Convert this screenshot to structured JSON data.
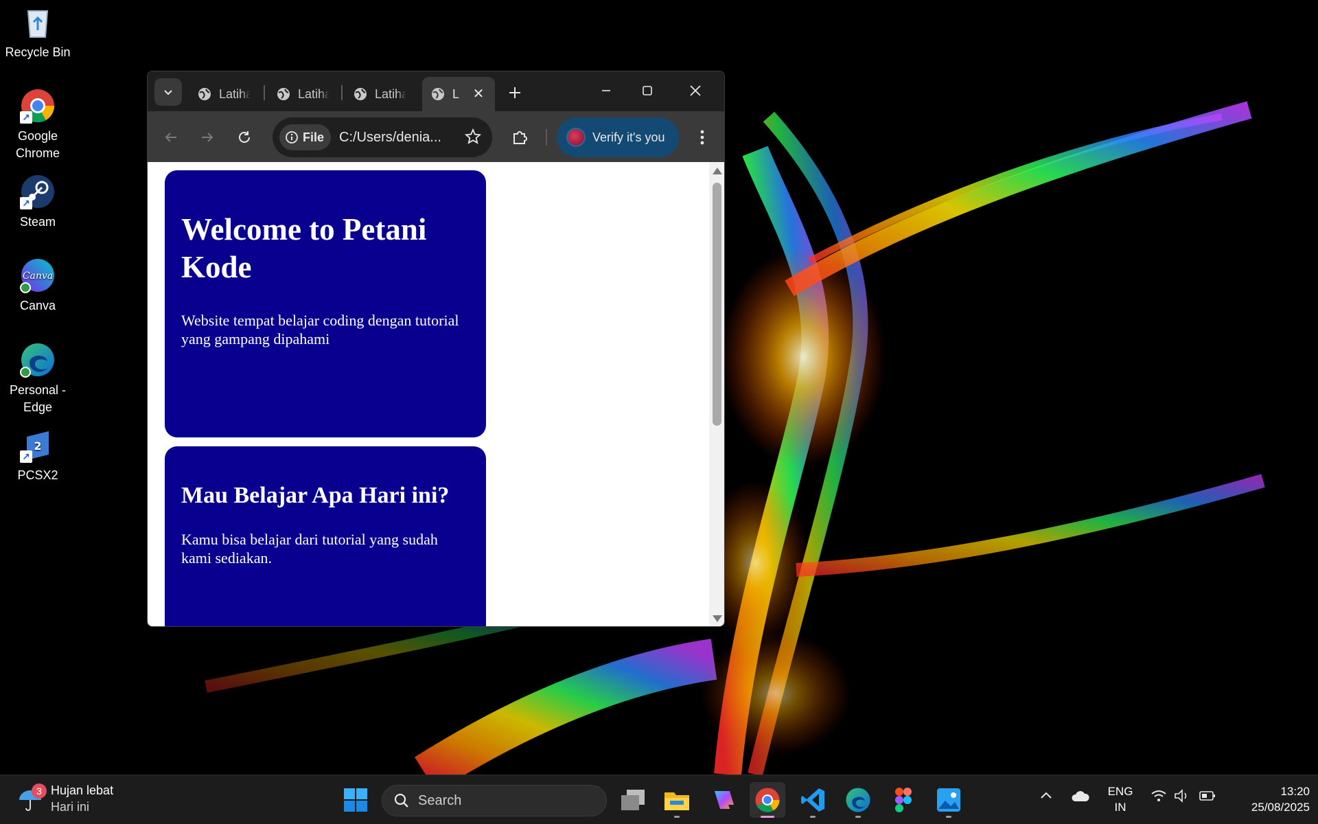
{
  "desktop": {
    "icons": [
      {
        "label": "Recycle Bin",
        "icon": "recycle-bin-icon"
      },
      {
        "label": "Google Chrome",
        "icon": "chrome-icon"
      },
      {
        "label": "Steam",
        "icon": "steam-icon"
      },
      {
        "label": "Canva",
        "icon": "canva-icon"
      },
      {
        "label": "Personal - Edge",
        "icon": "edge-icon"
      },
      {
        "label": "PCSX2",
        "icon": "pcsx2-icon"
      }
    ]
  },
  "browser": {
    "tabs": [
      {
        "title": "Latihan",
        "icon": "globe-icon",
        "active": false
      },
      {
        "title": "Latihan",
        "icon": "globe-icon",
        "active": false
      },
      {
        "title": "Latihan",
        "icon": "globe-icon",
        "active": false
      },
      {
        "title": "L",
        "icon": "globe-icon",
        "active": true
      }
    ],
    "omnibox": {
      "chip_label": "File",
      "url": "C:/Users/denia..."
    },
    "verify_label": "Verify it's you",
    "colors": {
      "frame": "#1f1f1f",
      "toolbar": "#3a3a3a",
      "verify": "#124a74"
    }
  },
  "page": {
    "cards": [
      {
        "heading": "Welcome to Petani Kode",
        "text": "Website tempat belajar coding dengan tutorial yang gampang dipahami"
      },
      {
        "heading": "Mau Belajar Apa Hari ini?",
        "text": "Kamu bisa belajar dari tutorial yang sudah kami sediakan."
      }
    ],
    "colors": {
      "card_bg": "#0a0090",
      "card_text": "#ffffff"
    }
  },
  "taskbar": {
    "weather": {
      "title": "Hujan lebat",
      "subtitle": "Hari ini",
      "badge": "3"
    },
    "search_placeholder": "Search",
    "apps": [
      "start-icon",
      "task-view-icon",
      "file-explorer-icon",
      "copilot-icon",
      "chrome-icon",
      "vscode-icon",
      "edge-icon",
      "figma-icon",
      "photos-icon"
    ],
    "lang_line1": "ENG",
    "lang_line2": "IN",
    "time": "13:20",
    "date": "25/08/2025"
  }
}
